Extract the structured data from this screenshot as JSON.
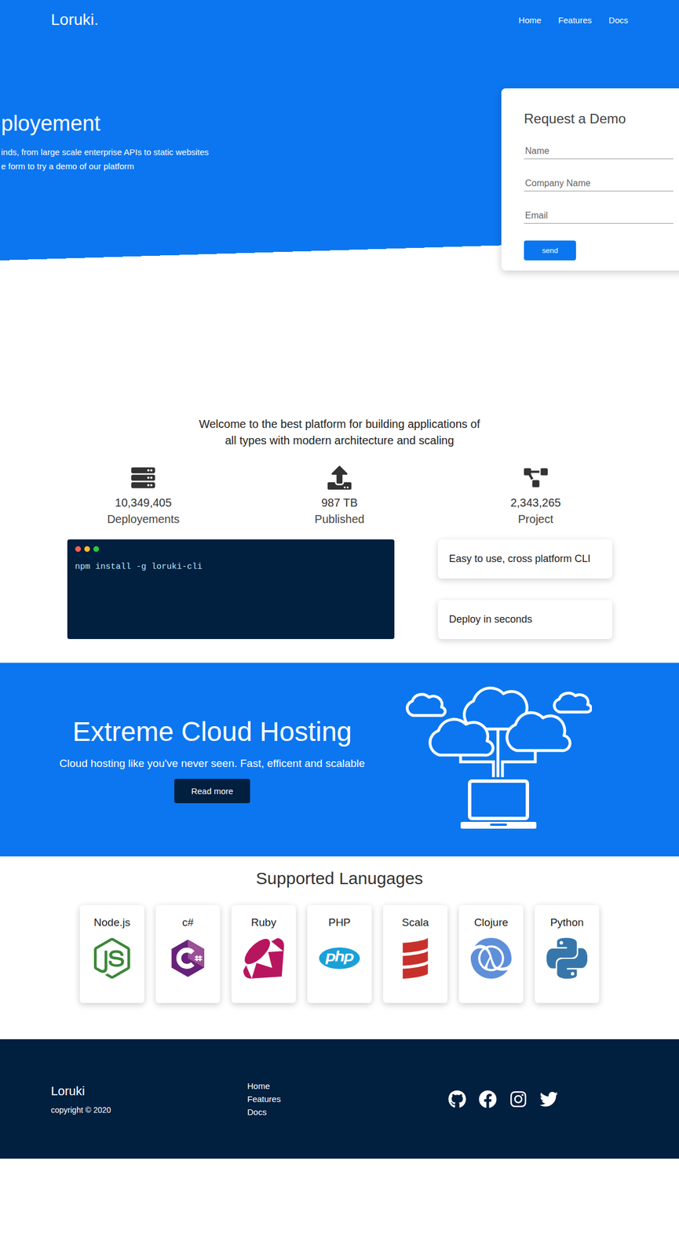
{
  "header": {
    "logo": "Loruki.",
    "nav": [
      {
        "label": "Home"
      },
      {
        "label": "Features"
      },
      {
        "label": "Docs"
      }
    ]
  },
  "hero": {
    "title": "ployement",
    "lines": [
      "inds, from large scale enterprise APIs to static websites",
      "e form to try a demo of our platform"
    ]
  },
  "demo_form": {
    "title": "Request a Demo",
    "fields": [
      {
        "placeholder": "Name"
      },
      {
        "placeholder": "Company Name"
      },
      {
        "placeholder": "Email"
      }
    ],
    "button": "send"
  },
  "welcome": "Welcome to the best platform for building applications of all types with modern architecture and scaling",
  "stats": [
    {
      "value": "10,349,405",
      "label": "Deployements"
    },
    {
      "value": "987 TB",
      "label": "Published"
    },
    {
      "value": "2,343,265",
      "label": "Project"
    }
  ],
  "cli": {
    "command": "npm install -g loruki-cli",
    "features": [
      "Easy to use, cross platform CLI",
      "Deploy in seconds"
    ]
  },
  "cloud": {
    "title": "Extreme Cloud Hosting",
    "subtitle": "Cloud hosting like you've never seen. Fast, efficent and scalable",
    "button": "Read more"
  },
  "languages": {
    "title": "Supported Lanugages",
    "items": [
      {
        "name": "Node.js",
        "color": "#3c873a"
      },
      {
        "name": "c#",
        "color": "#7b3a9e"
      },
      {
        "name": "Ruby",
        "color": "#b8155f"
      },
      {
        "name": "PHP",
        "color": "#1ba0d8"
      },
      {
        "name": "Scala",
        "color": "#c8312b"
      },
      {
        "name": "Clojure",
        "color": "#5f8fd9"
      },
      {
        "name": "Python",
        "color": "#3776ab"
      }
    ]
  },
  "footer": {
    "logo": "Loruki",
    "copyright": "copyright © 2020",
    "links": [
      "Home",
      "Features",
      "Docs"
    ]
  }
}
